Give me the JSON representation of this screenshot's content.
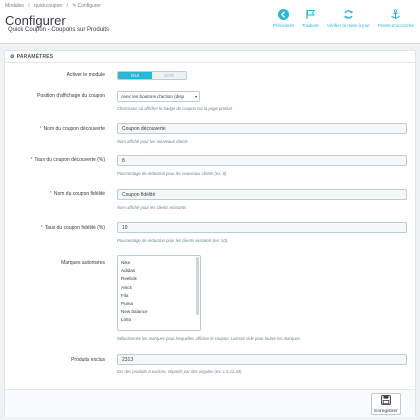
{
  "breadcrumb": [
    "Modules",
    "/",
    "quickcoupon",
    "/",
    "Configurer"
  ],
  "page_title": "Configurer",
  "page_subtitle": "Quick Coupon - Coupons sur Produits",
  "toolbar": {
    "precedent": "Précédent",
    "traduire": "Traduire",
    "verifier": "Vérifier la mise à jour",
    "accrocher": "Points d'accroche"
  },
  "panel": {
    "title": "PARAMÈTRES",
    "active_label": "Activer le module",
    "active_on": "OUI",
    "active_off": "NON",
    "position_label": "Position d'affichage du coupon",
    "position_value": "Avec les boutons d'action (disp",
    "position_help": "Choisissez où afficher le badge de coupon sur la page produit",
    "discovery_name_label": "Nom du coupon découverte",
    "discovery_name_value": "Coupon découverte",
    "discovery_name_help": "Nom affiché pour les nouveaux clients",
    "discovery_rate_label": "Taux du coupon découverte (%)",
    "discovery_rate_value": "8",
    "discovery_rate_help": "Pourcentage de réduction pour les nouveaux clients (ex: 8)",
    "loyalty_name_label": "Nom du coupon fidélité",
    "loyalty_name_value": "Coupon fidélité",
    "loyalty_name_help": "Nom affiché pour les clients existants",
    "loyalty_rate_label": "Taux du coupon fidélité (%)",
    "loyalty_rate_value": "10",
    "loyalty_rate_help": "Pourcentage de réduction pour les clients existants (ex: 10)",
    "brands_label": "Marques autorisées",
    "brands": [
      "Nike",
      "Adidas",
      "Reebok",
      "Asics",
      "Fila",
      "Puma",
      "New balance",
      "Lotto"
    ],
    "brands_help": "Sélectionnez les marques pour lesquelles afficher le coupon. Laissez vide pour toutes les marques.",
    "excluded_label": "Produits exclus",
    "excluded_value": "2313",
    "excluded_help": "IDs des produits à exclure, séparés par des virgules (ex: 1,5,12,34)",
    "save_label": "Enregistrer"
  },
  "colors": {
    "accent": "#25b9d7",
    "required": "#c05c67"
  }
}
